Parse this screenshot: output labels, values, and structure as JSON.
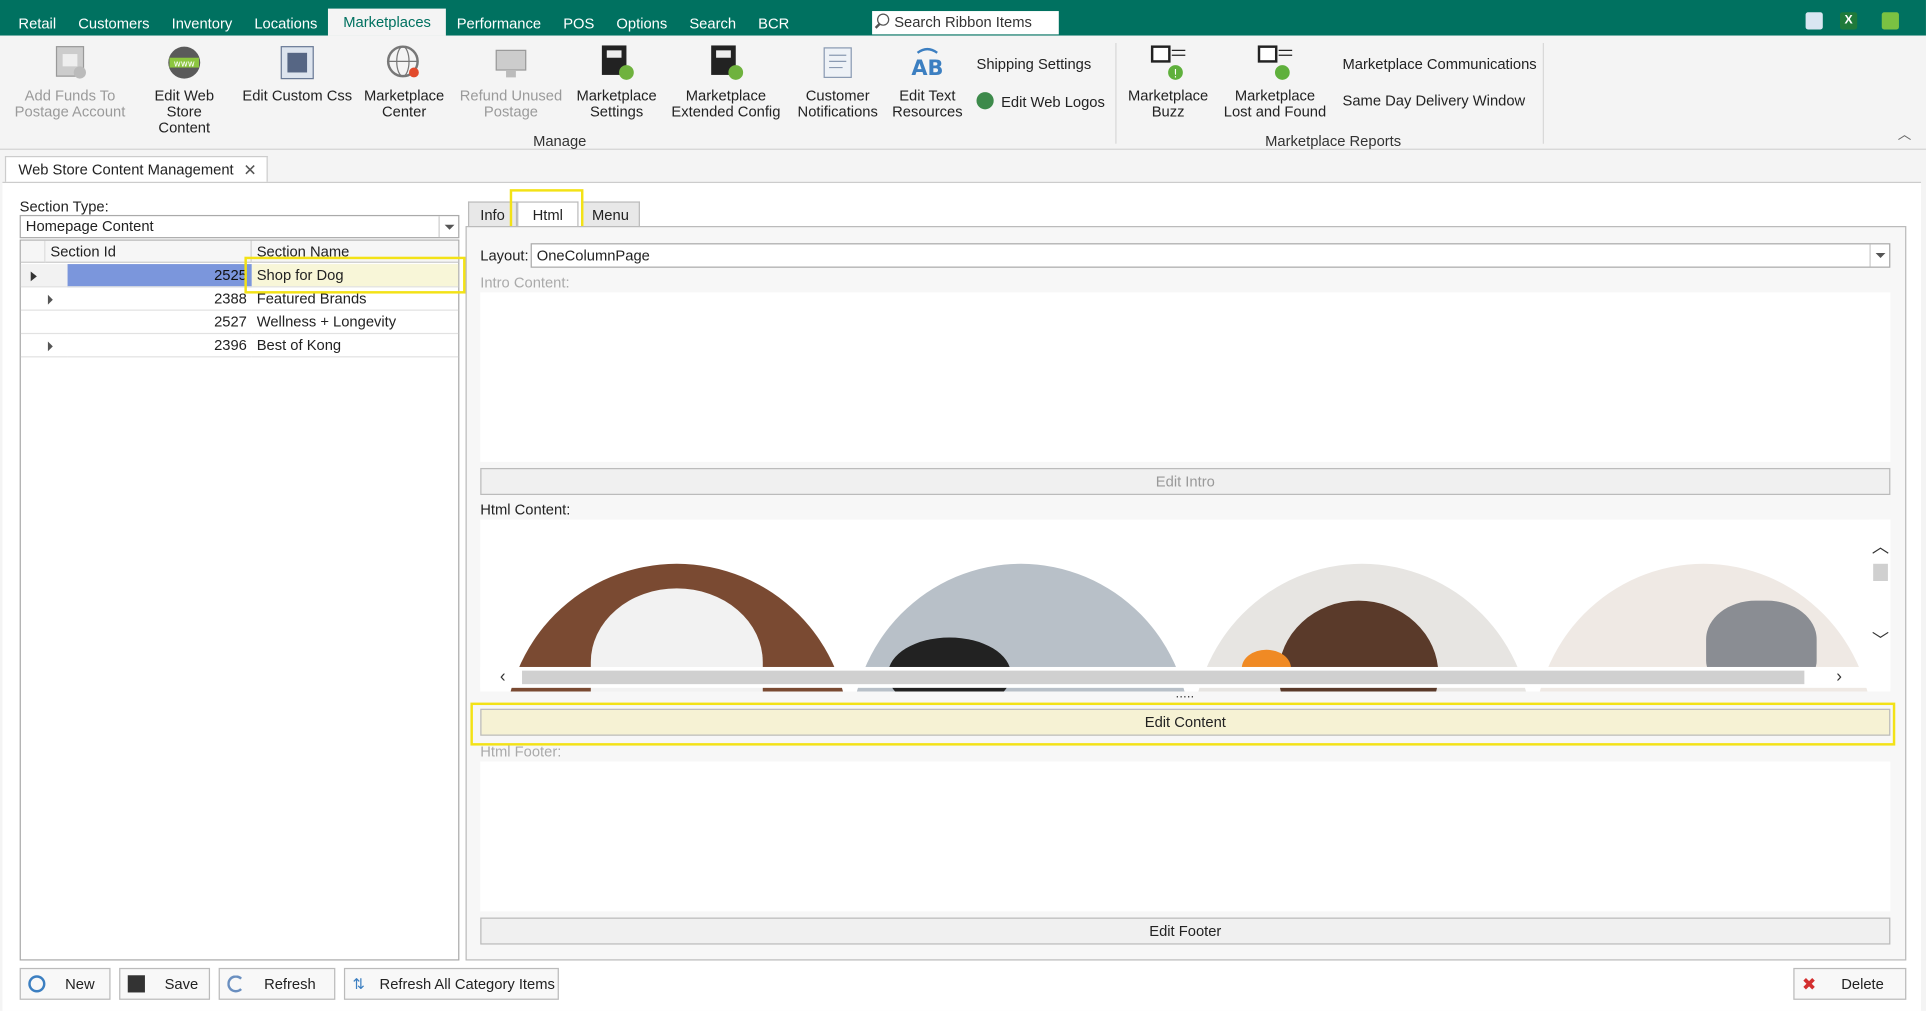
{
  "menu": {
    "tabs": [
      "Retail",
      "Customers",
      "Inventory",
      "Locations",
      "Marketplaces",
      "Performance",
      "POS",
      "Options",
      "Search",
      "BCR"
    ],
    "active_tab": "Marketplaces",
    "search_placeholder": "Search Ribbon Items"
  },
  "ribbon": {
    "add_funds": "Add Funds To Postage Account",
    "edit_web_store": "Edit Web Store Content",
    "edit_custom_css": "Edit Custom Css",
    "marketplace_center": "Marketplace Center",
    "refund_postage": "Refund Unused Postage",
    "marketplace_settings": "Marketplace Settings",
    "marketplace_extended": "Marketplace Extended Config",
    "customer_notifications": "Customer Notifications",
    "edit_text_resources": "Edit Text Resources",
    "shipping_settings": "Shipping Settings",
    "edit_web_logos": "Edit Web Logos",
    "manage_group": "Manage",
    "marketplace_buzz": "Marketplace Buzz",
    "lost_found": "Marketplace Lost and Found",
    "mp_communications": "Marketplace Communications",
    "same_day": "Same Day Delivery Window",
    "reports_group": "Marketplace Reports"
  },
  "doc_tab": "Web Store Content Management",
  "left": {
    "section_type_label": "Section Type:",
    "section_type_value": "Homepage Content",
    "col_id": "Section Id",
    "col_name": "Section Name",
    "rows": [
      {
        "id": "2525",
        "name": "Shop for Dog"
      },
      {
        "id": "2388",
        "name": "Featured Brands"
      },
      {
        "id": "2527",
        "name": "Wellness + Longevity"
      },
      {
        "id": "2396",
        "name": "Best of Kong"
      }
    ]
  },
  "right": {
    "tabs": [
      "Info",
      "Html",
      "Menu"
    ],
    "active_tab": "Html",
    "layout_label": "Layout:",
    "layout_value": "OneColumnPage",
    "intro_label": "Intro Content:",
    "edit_intro": "Edit Intro",
    "html_label": "Html Content:",
    "splitter": ".....",
    "edit_content": "Edit Content",
    "footer_label": "Html Footer:",
    "edit_footer": "Edit Footer"
  },
  "bottom": {
    "new": "New",
    "save": "Save",
    "refresh": "Refresh",
    "refresh_all": "Refresh All Category Items",
    "delete": "Delete"
  },
  "colors": {
    "brand": "#007160",
    "highlight": "#f3e216",
    "selection": "#7b96dc"
  }
}
